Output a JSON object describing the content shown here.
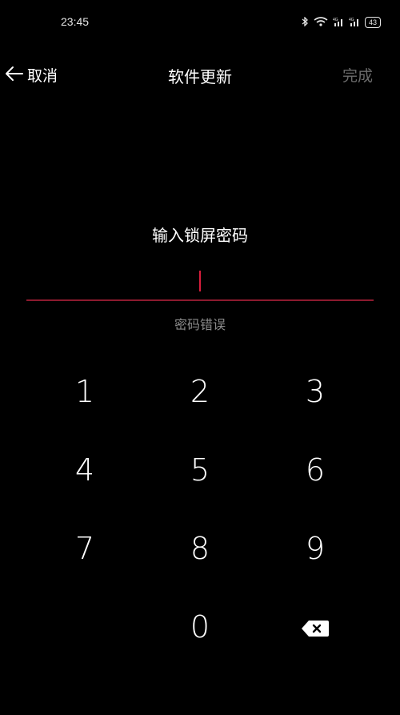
{
  "status_bar": {
    "time": "23:45",
    "battery": "43",
    "icons": [
      "bluetooth-icon",
      "wifi-icon",
      "signal-4g-icon",
      "signal-4g-icon",
      "battery-icon"
    ]
  },
  "nav": {
    "back_label": "取消",
    "title": "软件更新",
    "done_label": "完成"
  },
  "lock": {
    "prompt": "输入锁屏密码",
    "password_value": "",
    "error": "密码错误"
  },
  "keypad": {
    "keys": [
      "1",
      "2",
      "3",
      "4",
      "5",
      "6",
      "7",
      "8",
      "9",
      "",
      "0",
      "backspace-icon"
    ]
  },
  "colors": {
    "background": "#000000",
    "accent": "#d81e3c",
    "disabled_text": "#6b6b6b",
    "secondary_text": "#8a8a8a"
  }
}
